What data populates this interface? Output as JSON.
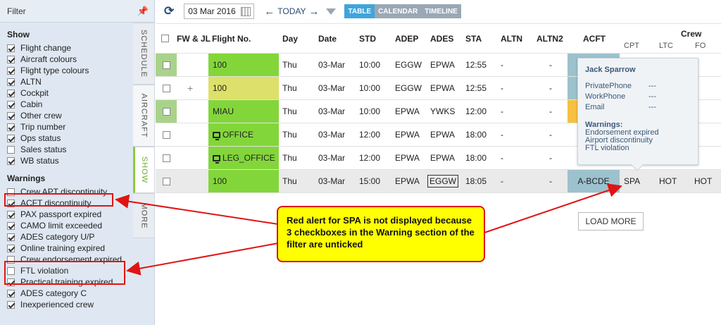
{
  "filter": {
    "title": "Filter",
    "show_title": "Show",
    "show_items": [
      {
        "label": "Flight change",
        "checked": true
      },
      {
        "label": "Aircraft colours",
        "checked": true
      },
      {
        "label": "Flight type colours",
        "checked": true
      },
      {
        "label": "ALTN",
        "checked": true
      },
      {
        "label": "Cockpit",
        "checked": true
      },
      {
        "label": "Cabin",
        "checked": true
      },
      {
        "label": "Other crew",
        "checked": true
      },
      {
        "label": "Trip number",
        "checked": true
      },
      {
        "label": "Ops status",
        "checked": true
      },
      {
        "label": "Sales status",
        "checked": false
      },
      {
        "label": "WB status",
        "checked": true
      }
    ],
    "warnings_title": "Warnings",
    "warning_items": [
      {
        "label": "Crew APT discontinuity",
        "checked": false
      },
      {
        "label": "ACFT discontinuity",
        "checked": true
      },
      {
        "label": "PAX passport expired",
        "checked": true
      },
      {
        "label": "CAMO limit exceeded",
        "checked": true
      },
      {
        "label": "ADES category U/P",
        "checked": true
      },
      {
        "label": "Online training expired",
        "checked": true
      },
      {
        "label": "Crew endorsement expired",
        "checked": false
      },
      {
        "label": "FTL violation",
        "checked": false
      },
      {
        "label": "Practical training expired",
        "checked": true
      },
      {
        "label": "ADES category C",
        "checked": true
      },
      {
        "label": "Inexperienced crew",
        "checked": true
      }
    ]
  },
  "side_tabs": {
    "schedule": "SCHEDULE",
    "aircraft": "AIRCRAFT",
    "show": "SHOW",
    "more": "MORE"
  },
  "toolbar": {
    "date": "03 Mar 2016",
    "today": "TODAY",
    "views": [
      "TABLE",
      "CALENDAR",
      "TIMELINE"
    ],
    "active_view": "TABLE"
  },
  "table": {
    "headers": {
      "fwjl": "FW & JL",
      "flight": "Flight No.",
      "day": "Day",
      "date": "Date",
      "std": "STD",
      "adep": "ADEP",
      "ades": "ADES",
      "sta": "STA",
      "altn": "ALTN",
      "altn2": "ALTN2",
      "acft": "ACFT",
      "crew": "Crew",
      "cpt": "CPT",
      "ltc": "LTC",
      "fo": "FO"
    },
    "rows": [
      {
        "plus": "",
        "flight": "100",
        "day": "Thu",
        "date": "03-Mar",
        "std": "10:00",
        "adep": "EGGW",
        "ades": "EPWA",
        "sta": "12:55",
        "altn": "-",
        "altn2": "-",
        "acft": "",
        "cpt": "",
        "ltc": "",
        "fo": ""
      },
      {
        "plus": "+",
        "flight": "100",
        "day": "Thu",
        "date": "03-Mar",
        "std": "10:00",
        "adep": "EGGW",
        "ades": "EPWA",
        "sta": "12:55",
        "altn": "-",
        "altn2": "-",
        "acft": "",
        "cpt": "",
        "ltc": "",
        "fo": ""
      },
      {
        "plus": "",
        "flight": "MIAU",
        "day": "Thu",
        "date": "03-Mar",
        "std": "10:00",
        "adep": "EPWA",
        "ades": "YWKS",
        "sta": "12:00",
        "altn": "-",
        "altn2": "-",
        "acft": "",
        "cpt": "",
        "ltc": "",
        "fo": ""
      },
      {
        "plus": "",
        "flight": "OFFICE",
        "day": "Thu",
        "date": "03-Mar",
        "std": "12:00",
        "adep": "EPWA",
        "ades": "EPWA",
        "sta": "18:00",
        "altn": "-",
        "altn2": "-",
        "acft": "",
        "cpt": "",
        "ltc": "",
        "fo": ""
      },
      {
        "plus": "",
        "flight": "LEG_OFFICE",
        "day": "Thu",
        "date": "03-Mar",
        "std": "12:00",
        "adep": "EPWA",
        "ades": "EPWA",
        "sta": "18:00",
        "altn": "-",
        "altn2": "-",
        "acft": "",
        "cpt": "",
        "ltc": "",
        "fo": ""
      },
      {
        "plus": "",
        "flight": "100",
        "day": "Thu",
        "date": "03-Mar",
        "std": "15:00",
        "adep": "EPWA",
        "ades": "EGGW",
        "sta": "18:05",
        "altn": "-",
        "altn2": "-",
        "acft": "A-BCDE",
        "cpt": "SPA",
        "ltc": "HOT",
        "fo": "HOT"
      }
    ]
  },
  "popup": {
    "name": "Jack Sparrow",
    "fields": [
      {
        "key": "PrivatePhone",
        "value": "---"
      },
      {
        "key": "WorkPhone",
        "value": "---"
      },
      {
        "key": "Email",
        "value": "---"
      }
    ],
    "warnings_title": "Warnings:",
    "warnings": [
      "Endorsement expired",
      "Airport discontinuity",
      "FTL violation"
    ]
  },
  "load_more": "LOAD MORE",
  "callout": "Red alert for SPA is not displayed because 3 checkboxes in the Warning section of the filter are unticked",
  "colors": {
    "flight_green": "#83d63a",
    "flight_yellow": "#dde06a",
    "acft_blue": "#9cc2ce",
    "acft_orange": "#f6c040",
    "alert_red": "#e01414",
    "callout_yellow": "#ffff00",
    "view_active": "#3fa5dc"
  }
}
